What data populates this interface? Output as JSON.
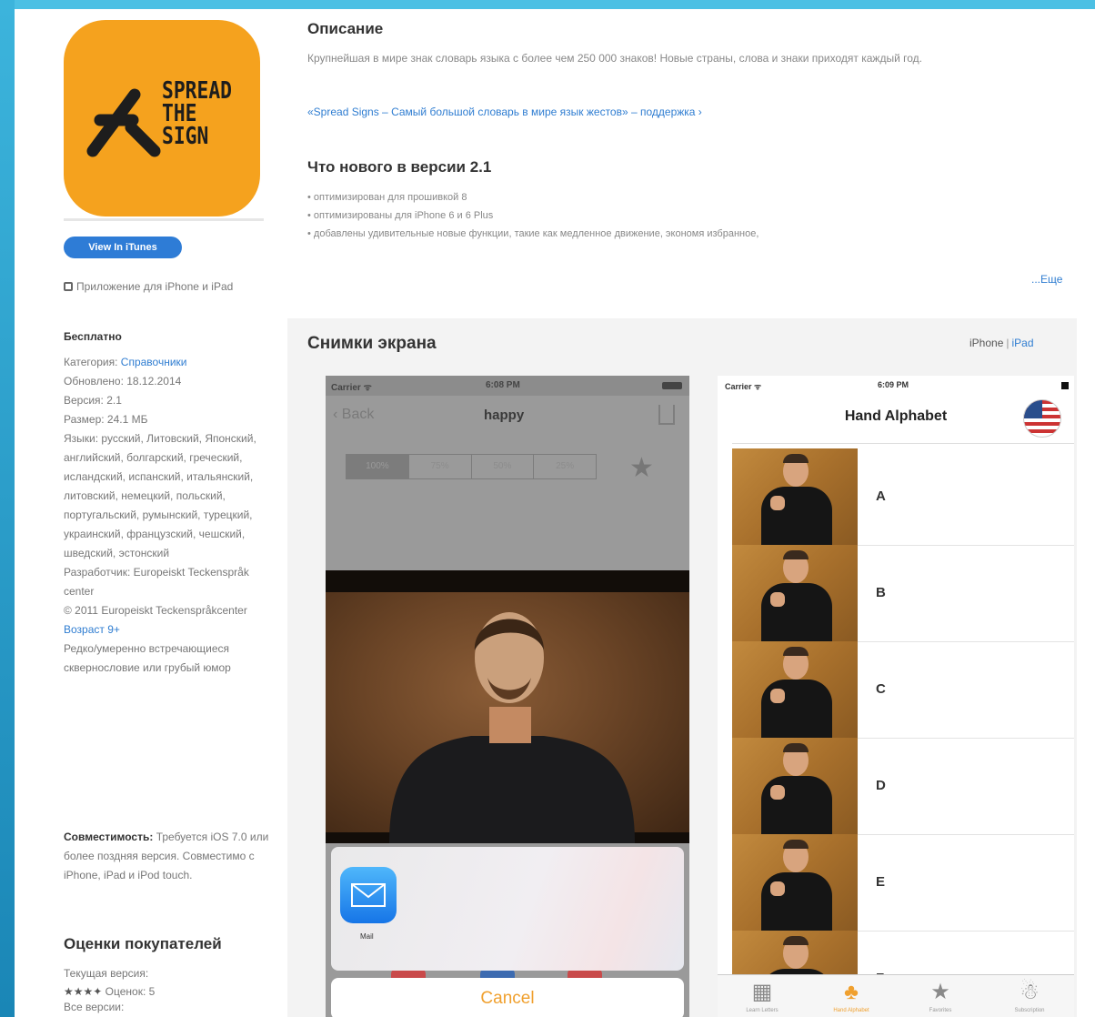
{
  "app": {
    "logo_text": "SPREAD\nTHE\nSIGN",
    "brand_color": "#f5a21e",
    "view_in_itunes": "View In iTunes",
    "app_type": "Приложение для iPhone и iPad",
    "price": "Бесплатно",
    "category_label": "Категория:",
    "category_value": "Справочники",
    "updated": "Обновлено: 18.12.2014",
    "version": "Версия: 2.1",
    "size": "Размер: 24.1 МБ",
    "languages": "Языки: русский, Литовский, Японский, английский, болгарский, греческий, исландский, испанский, итальянский, литовский, немецкий, польский, португальский, румынский, турецкий, украинский, французский, чешский, шведский, эстонский",
    "developer": "Разработчик: Europeiskt Teckenspråk center",
    "copyright": "© 2011 Europeiskt Teckenspråkcenter",
    "age": "Возраст 9+",
    "age_note": "Редко/умеренно встречающиеся сквернословие или грубый юмор",
    "compat_label": "Совместимость:",
    "compat_text": "Требуется iOS 7.0 или более поздняя версия. Совместимо с iPhone, iPad и iPod touch.",
    "ratings_title": "Оценки покупателей",
    "current_version_label": "Текущая версия:",
    "current_rating_stars": "★★★✦",
    "current_rating_count": "Оценок: 5",
    "all_versions_label": "Все версии:"
  },
  "description": {
    "title": "Описание",
    "body": "Крупнейшая в мире знак словарь языка с более чем 250 000 знаков! Новые страны, слова и знаки приходят каждый год.",
    "support_link": "«Spread Signs – Самый большой словарь в мире язык жестов» – поддержка ›",
    "whats_new_title": "Что нового в версии 2.1",
    "whats_new_items": [
      "• оптимизирован для прошивкой 8",
      "• оптимизированы для iPhone 6 и 6 Plus",
      "• добавлены удивительные новые функции, такие как медленное движение, экономя избранное,"
    ],
    "more_link": "...Еще"
  },
  "screenshots": {
    "title": "Снимки экрана",
    "toggle_iphone": "iPhone",
    "toggle_sep": "|",
    "toggle_ipad": "iPad",
    "shot1": {
      "carrier": "Carrier ᯤ",
      "time": "6:08 PM",
      "back": "‹ Back",
      "nav_title": "happy",
      "segments": [
        "100%",
        "75%",
        "50%",
        "25%"
      ],
      "fav_icon": "★",
      "mail_label": "Mail",
      "cancel": "Cancel"
    },
    "shot2": {
      "carrier": "Carrier ᯤ",
      "time": "6:09 PM",
      "title": "Hand Alphabet",
      "letters": [
        "A",
        "B",
        "C",
        "D",
        "E",
        "F"
      ],
      "tabs": [
        {
          "icon": "▦",
          "label": "Learn Letters"
        },
        {
          "icon": "♣",
          "label": "Hand Alphabet"
        },
        {
          "icon": "★",
          "label": "Favorites"
        },
        {
          "icon": "☃",
          "label": "Subscription"
        }
      ]
    }
  }
}
